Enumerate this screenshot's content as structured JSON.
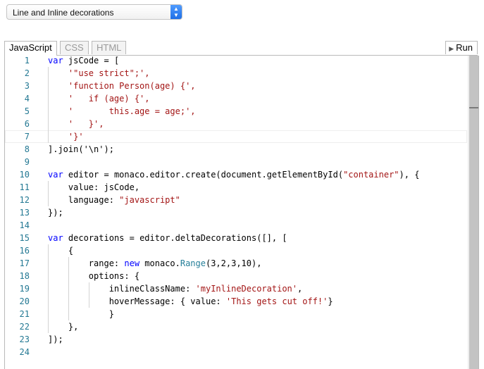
{
  "sample_select": {
    "selected": "Line and Inline decorations"
  },
  "tabs": [
    "JavaScript",
    "CSS",
    "HTML"
  ],
  "active_tab": "JavaScript",
  "run_label": "Run",
  "editor": {
    "line_numbers": [
      "1",
      "2",
      "3",
      "4",
      "5",
      "6",
      "7",
      "8",
      "9",
      "10",
      "11",
      "12",
      "13",
      "14",
      "15",
      "16",
      "17",
      "18",
      "19",
      "20",
      "21",
      "22",
      "23",
      "24"
    ],
    "lines": [
      [
        [
          "kw",
          "var"
        ],
        [
          "",
          "jsCode = ["
        ]
      ],
      [
        [
          "",
          "    "
        ],
        [
          "str",
          "'\"use strict\";',"
        ]
      ],
      [
        [
          "",
          "    "
        ],
        [
          "str",
          "'function Person(age) {',"
        ]
      ],
      [
        [
          "",
          "    "
        ],
        [
          "str",
          "'   if (age) {',"
        ]
      ],
      [
        [
          "",
          "    "
        ],
        [
          "str",
          "'       this.age = age;',"
        ]
      ],
      [
        [
          "",
          "    "
        ],
        [
          "str",
          "'   }',"
        ]
      ],
      [
        [
          "",
          "    "
        ],
        [
          "str",
          "'}'"
        ]
      ],
      [
        [
          "",
          "].join('\\n');"
        ]
      ],
      [],
      [
        [
          "kw",
          "var"
        ],
        [
          "",
          "editor = monaco.editor.create(document.getElementById("
        ],
        [
          "str",
          "\"container\""
        ],
        [
          "",
          "), {"
        ]
      ],
      [
        [
          "",
          "    value: jsCode,"
        ]
      ],
      [
        [
          "",
          "    language: "
        ],
        [
          "str",
          "\"javascript\""
        ]
      ],
      [
        [
          "",
          "});"
        ]
      ],
      [],
      [
        [
          "kw",
          "var"
        ],
        [
          "",
          "decorations = editor.deltaDecorations([], ["
        ]
      ],
      [
        [
          "",
          "    {"
        ]
      ],
      [
        [
          "",
          "        range: "
        ],
        [
          "kw",
          "new"
        ],
        [
          "",
          " monaco."
        ],
        [
          "cls",
          "Range"
        ],
        [
          "",
          "(3,2,3,10),"
        ]
      ],
      [
        [
          "",
          "        options: {"
        ]
      ],
      [
        [
          "",
          "            inlineClassName: "
        ],
        [
          "str",
          "'myInlineDecoration'"
        ],
        [
          "",
          ","
        ]
      ],
      [
        [
          "",
          "            hoverMessage: { value: "
        ],
        [
          "str",
          "'This gets cut off!'"
        ],
        [
          "",
          "}"
        ]
      ],
      [
        [
          "",
          "            }"
        ]
      ],
      [
        [
          "",
          "    },"
        ]
      ],
      [
        [
          "",
          "]);"
        ]
      ],
      []
    ]
  }
}
